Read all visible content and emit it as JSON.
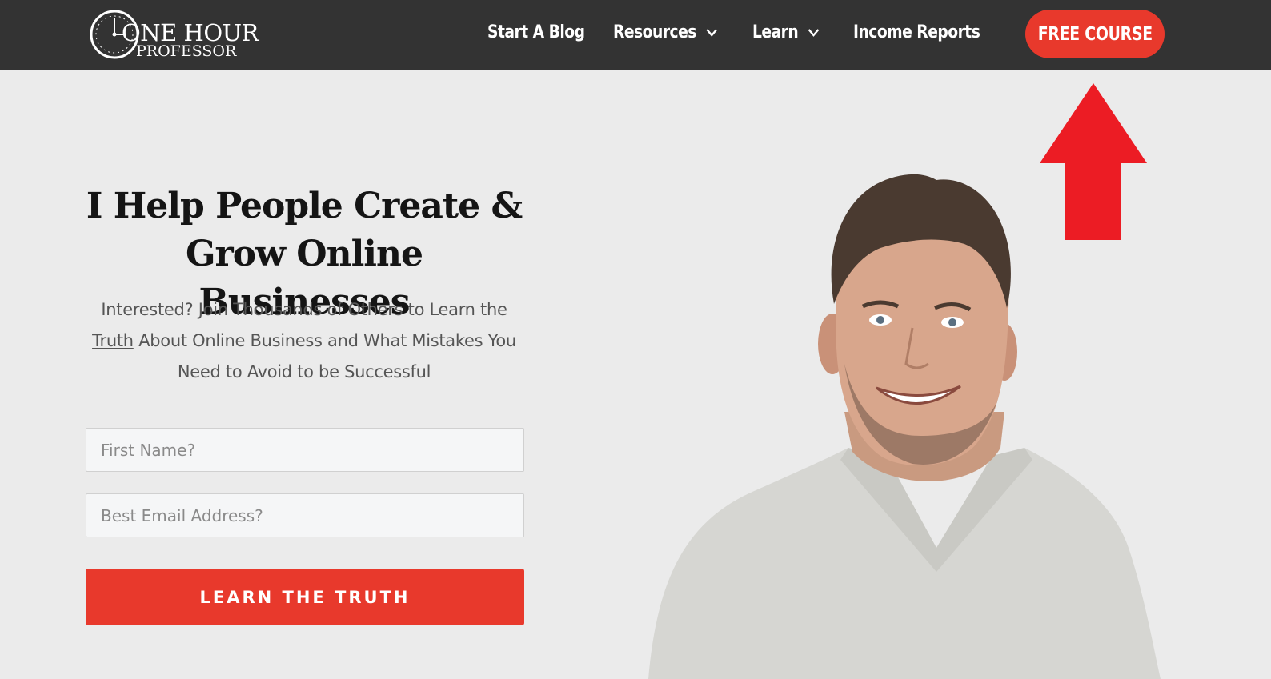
{
  "header": {
    "logo": {
      "line1": "ONE HOUR",
      "line2": "PROFESSOR"
    },
    "nav": [
      {
        "label": "Start A Blog",
        "has_dropdown": false
      },
      {
        "label": "Resources",
        "has_dropdown": true
      },
      {
        "label": "Learn",
        "has_dropdown": true
      },
      {
        "label": "Income Reports",
        "has_dropdown": false
      }
    ],
    "cta_label": "FREE COURSE"
  },
  "hero": {
    "headline_line1": "I Help People Create &",
    "headline_line2": "Grow Online Businesses",
    "sub_pre": "Interested? Join Thousands of Others to Learn the",
    "sub_link": "Truth",
    "sub_post": "About Online Business and What Mistakes You Need to Avoid to be Successful",
    "form": {
      "first_name_placeholder": "First Name?",
      "email_placeholder": "Best Email Address?",
      "submit_label": "LEARN THE TRUTH"
    }
  },
  "annotation": {
    "arrow_icon": "up-arrow-icon"
  },
  "colors": {
    "nav_bg": "#333333",
    "accent_red": "#e8392c",
    "arrow_red": "#ec1c24",
    "page_bg": "#ebebeb"
  }
}
